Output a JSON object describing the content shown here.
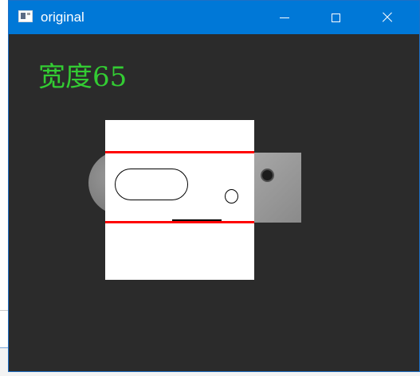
{
  "window": {
    "title": "original",
    "titlebar_color": "#0078d7",
    "controls": {
      "minimize": "minimize-icon",
      "maximize": "maximize-icon",
      "close": "close-icon"
    }
  },
  "image": {
    "width_label": "宽度65",
    "label_color": "#33cc33",
    "edge_color": "#ff0000"
  }
}
